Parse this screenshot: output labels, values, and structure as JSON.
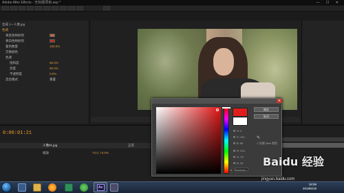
{
  "window": {
    "title": "Adobe After Effects - 无标题项目.aep *",
    "controls": "— ☐ ✕"
  },
  "left_panel": {
    "layer_title": "合成 1 • 人像.jpg",
    "effect_name": "色调",
    "rows": [
      "将黑色映射到",
      "将白色映射到",
      "着色数量",
      "交换颜色",
      "色调",
      "饱和度",
      "亮度",
      "不透明度",
      "混合模式"
    ],
    "values": [
      "重置",
      "100.0%",
      "50.0%",
      "50.0%",
      "0.0%"
    ]
  },
  "timeline": {
    "timecode": "0:00:01:21",
    "layer_name": "人像01.jpg",
    "property_name": "缩放",
    "property_value": "73.0, 73.0%",
    "mode": "正常"
  },
  "dialog": {
    "ok_label": "确定",
    "cancel_label": "取消",
    "fields": [
      {
        "label": "H",
        "value": "0"
      },
      {
        "label": "S",
        "value": "100"
      },
      {
        "label": "B",
        "value": "88"
      },
      {
        "label": "R",
        "value": "224"
      },
      {
        "label": "G",
        "value": "29"
      },
      {
        "label": "B",
        "value": "29"
      }
    ],
    "hex_label": "#",
    "hex_value": "E01D1D",
    "only_web_colors": "仅限 Web 颜色",
    "selected_color": "#e01d1d",
    "previous_color": "#ffffff",
    "hue_degrees": 0,
    "saturation": 1.0,
    "brightness": 0.88
  },
  "taskbar": {
    "time": "18:06",
    "date": "2019/6/18",
    "ae_label": "Ae"
  },
  "watermark": {
    "logo": "Baidu 经验",
    "url": "jingyan.baidu.com"
  }
}
